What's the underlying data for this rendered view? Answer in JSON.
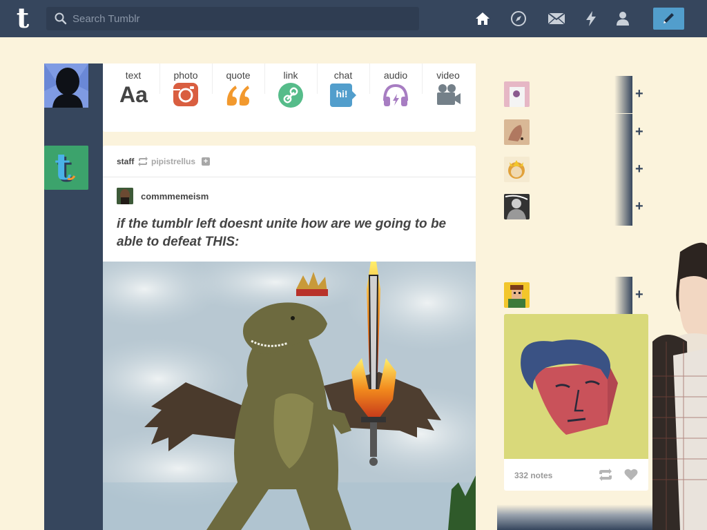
{
  "header": {
    "logo": "t",
    "search_placeholder": "Search Tumblr",
    "nav_icons": [
      "home-icon",
      "explore-icon",
      "inbox-icon",
      "activity-icon",
      "account-icon"
    ],
    "compose_icon": "pencil-icon",
    "background_color": "#36465d",
    "compose_color": "#529ecc"
  },
  "post_types": [
    {
      "label": "text",
      "icon": "Aa",
      "color": "#444444"
    },
    {
      "label": "photo",
      "icon": "camera-icon",
      "color": "#d95e40"
    },
    {
      "label": "quote",
      "icon": "quote-icon",
      "color": "#f2992e"
    },
    {
      "label": "link",
      "icon": "link-icon",
      "color": "#56bc8a"
    },
    {
      "label": "chat",
      "icon": "hi!",
      "color": "#529ecc"
    },
    {
      "label": "audio",
      "icon": "headphones-icon",
      "color": "#a77dc2"
    },
    {
      "label": "video",
      "icon": "video-camera-icon",
      "color": "#748089"
    }
  ],
  "post": {
    "blog_name": "staff",
    "reblogged_from": "pipistrellus",
    "reblogger": "commmemeism",
    "title": "if the tumblr left doesnt unite how are we going to be able to defeat THIS:",
    "image_subject": "dinosaur-with-crown-wings-and-flaming-sword"
  },
  "sidebar": {
    "recommended": [
      {
        "name": "",
        "plus": "+",
        "colors": [
          "#e6b7c5",
          "#8a5a8e"
        ]
      },
      {
        "name": "",
        "plus": "+",
        "colors": [
          "#d9b896",
          "#b07860"
        ]
      },
      {
        "name": "",
        "plus": "+",
        "colors": [
          "#f0d9b0",
          "#e1a13a"
        ]
      },
      {
        "name": "",
        "plus": "+",
        "colors": [
          "#333333",
          "#cccccc"
        ]
      }
    ],
    "radar": {
      "plus": "+",
      "avatar_colors": [
        "#f2c62b",
        "#3d7a3a"
      ],
      "notes": "332 notes"
    }
  }
}
